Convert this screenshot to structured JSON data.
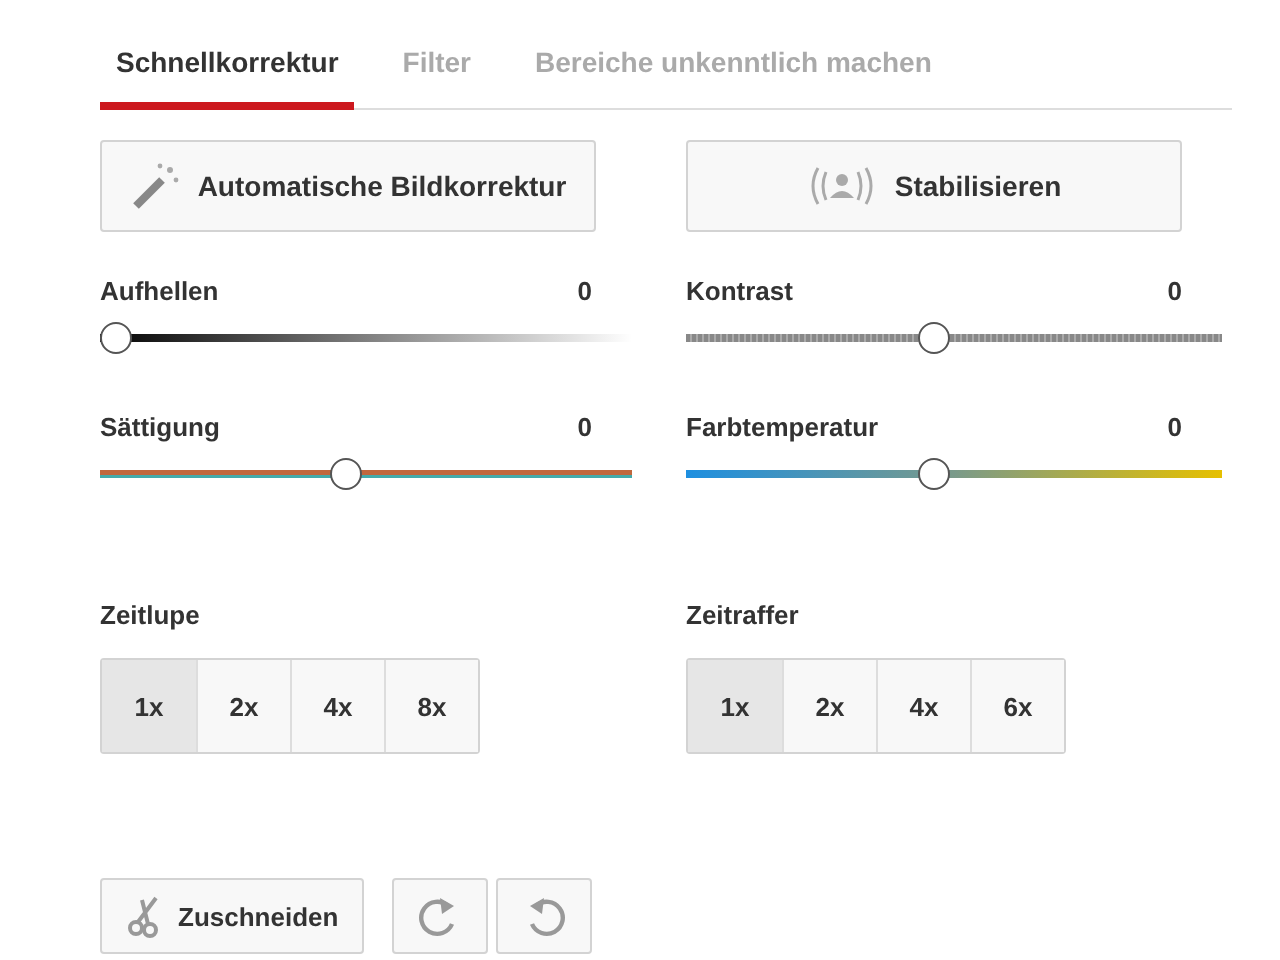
{
  "tabs": [
    {
      "label": "Schnellkorrektur",
      "selected": true
    },
    {
      "label": "Filter",
      "selected": false
    },
    {
      "label": "Bereiche unkenntlich machen",
      "selected": false
    }
  ],
  "actions": [
    {
      "label": "Automatische Bildkorrektur",
      "kind": "wand"
    },
    {
      "label": "Stabilisieren",
      "kind": "stabilize"
    }
  ],
  "sliders": [
    {
      "label": "Aufhellen",
      "reading": "0",
      "kind": "brightness",
      "level": 0.0
    },
    {
      "label": "Kontrast",
      "reading": "0",
      "kind": "contrast",
      "level": 0.46
    },
    {
      "label": "Sättigung",
      "reading": "0",
      "kind": "saturation",
      "level": 0.46
    },
    {
      "label": "Farbtemperatur",
      "reading": "0",
      "kind": "temperature",
      "level": 0.46
    }
  ],
  "speeds": [
    {
      "label": "Zeitlupe",
      "options": [
        {
          "label": "1x",
          "selected": true
        },
        {
          "label": "2x",
          "selected": false
        },
        {
          "label": "4x",
          "selected": false
        },
        {
          "label": "8x",
          "selected": false
        }
      ]
    },
    {
      "label": "Zeitraffer",
      "options": [
        {
          "label": "1x",
          "selected": true
        },
        {
          "label": "2x",
          "selected": false
        },
        {
          "label": "4x",
          "selected": false
        },
        {
          "label": "6x",
          "selected": false
        }
      ]
    }
  ],
  "crop": {
    "label": "Zuschneiden"
  },
  "rotate": [
    {
      "kind": "right"
    },
    {
      "kind": "left"
    }
  ]
}
